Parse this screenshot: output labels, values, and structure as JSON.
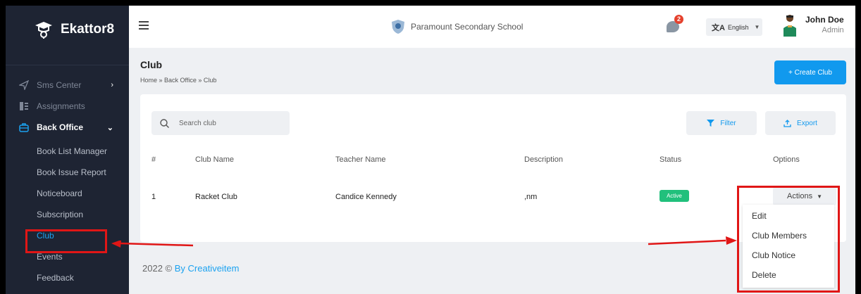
{
  "brand": {
    "name": "Ekattor8"
  },
  "sidebar": {
    "items": [
      {
        "label": "Sms Center",
        "icon": "send-icon",
        "has_arrow": true
      },
      {
        "label": "Assignments",
        "icon": "assignment-icon"
      },
      {
        "label": "Back Office",
        "icon": "briefcase-icon",
        "active": true
      }
    ],
    "sub_items": [
      {
        "label": "Book List Manager"
      },
      {
        "label": "Book Issue Report"
      },
      {
        "label": "Noticeboard"
      },
      {
        "label": "Subscription"
      },
      {
        "label": "Club",
        "current": true
      },
      {
        "label": "Events"
      },
      {
        "label": "Feedback"
      }
    ]
  },
  "header": {
    "school_name": "Paramount Secondary School",
    "notification_count": "2",
    "language": "English",
    "user_name": "John Doe",
    "user_role": "Admin"
  },
  "page": {
    "title": "Club",
    "breadcrumb": "Home » Back Office » Club",
    "create_label": "+ Create Club"
  },
  "toolbar": {
    "search_placeholder": "Search club",
    "filter_label": "Filter",
    "export_label": "Export"
  },
  "table": {
    "columns": [
      "#",
      "Club Name",
      "Teacher Name",
      "Description",
      "Status",
      "Options"
    ],
    "rows": [
      {
        "num": "1",
        "club_name": "Racket Club",
        "teacher": "Candice Kennedy",
        "description": ",nm",
        "status": "Active",
        "actions_label": "Actions"
      }
    ]
  },
  "dropdown": {
    "options": [
      "Edit",
      "Club Members",
      "Club Notice",
      "Delete"
    ]
  },
  "footer": {
    "text": "2022 © ",
    "link": "By Creativeitem"
  },
  "colors": {
    "sidebar": "#1e2433",
    "accent": "#1199ee",
    "active": "#21c07c",
    "highlight": "#e01616"
  }
}
